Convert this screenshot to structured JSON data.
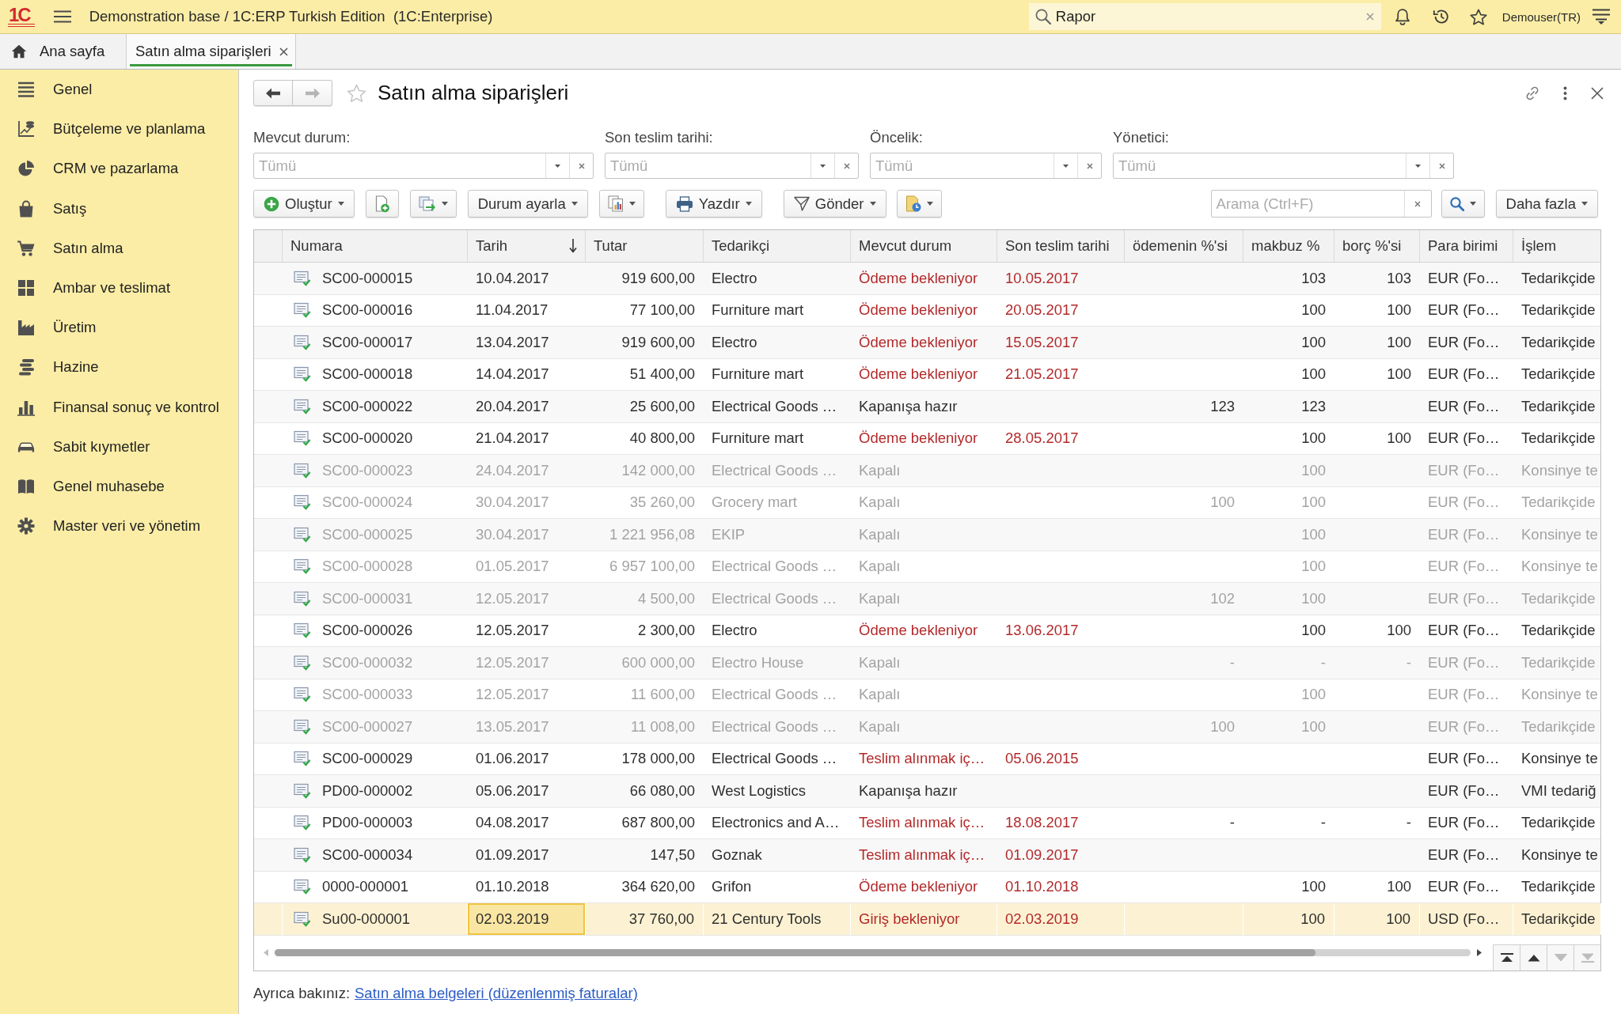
{
  "app": {
    "logo": "1C",
    "title": "Demonstration base / 1C:ERP Turkish Edition  (1C:Enterprise)",
    "search": {
      "value": "Rapor"
    },
    "user": "Demouser(TR)"
  },
  "tabs": [
    {
      "kind": "home",
      "label": "Ana sayfa",
      "selected": false
    },
    {
      "kind": "form",
      "label": "Satın alma siparişleri",
      "selected": true
    }
  ],
  "sidebar": {
    "items": [
      {
        "kind": "general",
        "label": "Genel",
        "selected": false
      },
      {
        "kind": "budget",
        "label": "Bütçeleme ve planlama",
        "selected": false
      },
      {
        "kind": "crm",
        "label": "CRM ve pazarlama",
        "selected": false
      },
      {
        "kind": "sales",
        "label": "Satış",
        "selected": false
      },
      {
        "kind": "purchase",
        "label": "Satın alma",
        "selected": false
      },
      {
        "kind": "warehouse",
        "label": "Ambar ve teslimat",
        "selected": false
      },
      {
        "kind": "production",
        "label": "Üretim",
        "selected": false
      },
      {
        "kind": "treasury",
        "label": "Hazine",
        "selected": false
      },
      {
        "kind": "finance",
        "label": "Finansal sonuç ve kontrol",
        "selected": false
      },
      {
        "kind": "assets",
        "label": "Sabit kıymetler",
        "selected": false
      },
      {
        "kind": "accounting",
        "label": "Genel muhasebe",
        "selected": false
      },
      {
        "kind": "settings",
        "label": "Master veri ve yönetim",
        "selected": false
      }
    ]
  },
  "form": {
    "title": "Satın alma siparişleri",
    "favorite": false,
    "back": {
      "disabled": false
    },
    "forward": {
      "disabled": true
    },
    "filters": [
      {
        "label": "Mevcut durum:",
        "placeholder": "Tümü"
      },
      {
        "label": "Son teslim tarihi:",
        "placeholder": "Tümü"
      },
      {
        "label": "Öncelik:",
        "placeholder": "Tümü"
      },
      {
        "label": "Yönetici:",
        "placeholder": "Tümü"
      }
    ],
    "toolbar": [
      {
        "kind": "create",
        "label": "Oluştur",
        "dropdown": true
      },
      {
        "kind": "copy",
        "dropdown": false
      },
      {
        "kind": "generate",
        "dropdown": true
      },
      {
        "kind": "status",
        "label": "Durum ayarla",
        "dropdown": true
      },
      {
        "kind": "reports",
        "dropdown": true
      },
      {
        "kind": "print",
        "label": "Yazdır",
        "dropdown": true
      },
      {
        "kind": "send",
        "label": "Gönder",
        "dropdown": true
      },
      {
        "kind": "attach",
        "dropdown": true
      }
    ],
    "search": {
      "placeholder": "Arama (Ctrl+F)"
    },
    "more_button": {
      "label": "Daha fazla"
    }
  },
  "table": {
    "columns": [
      {
        "label": "Numara",
        "sorted": false,
        "focused": false
      },
      {
        "label": "Tarih",
        "sorted": true,
        "focused": true
      },
      {
        "label": "Tutar",
        "sorted": false,
        "focused": false
      },
      {
        "label": "Tedarikçi",
        "sorted": false,
        "focused": false
      },
      {
        "label": "Mevcut durum",
        "sorted": false,
        "focused": false
      },
      {
        "label": "Son teslim tarihi",
        "sorted": false,
        "focused": false
      },
      {
        "label": "ödemenin %'si",
        "sorted": false,
        "focused": false
      },
      {
        "label": "makbuz %",
        "sorted": false,
        "focused": false
      },
      {
        "label": "borç %'si",
        "sorted": false,
        "focused": false
      },
      {
        "label": "Para birimi",
        "sorted": false,
        "focused": false
      },
      {
        "label": "İşlem",
        "sorted": false,
        "focused": false
      }
    ],
    "rows": [
      {
        "kind": "alert",
        "selected": false,
        "posted": true,
        "number": "SC00-000015",
        "date": "10.04.2017",
        "amount": "919 600,00",
        "supplier": "Electro",
        "status": "Ödeme bekleniyor",
        "due_date": "10.05.2017",
        "receipt_pct": "103",
        "debt_pct": "103",
        "currency": "EUR (Fo…",
        "operation": "Tedarikçide"
      },
      {
        "kind": "alert",
        "selected": false,
        "posted": true,
        "number": "SC00-000016",
        "date": "11.04.2017",
        "amount": "77 100,00",
        "supplier": "Furniture mart",
        "status": "Ödeme bekleniyor",
        "due_date": "20.05.2017",
        "receipt_pct": "100",
        "debt_pct": "100",
        "currency": "EUR (Fo…",
        "operation": "Tedarikçide"
      },
      {
        "kind": "alert",
        "selected": false,
        "posted": true,
        "number": "SC00-000017",
        "date": "13.04.2017",
        "amount": "919 600,00",
        "supplier": "Electro",
        "status": "Ödeme bekleniyor",
        "due_date": "15.05.2017",
        "receipt_pct": "100",
        "debt_pct": "100",
        "currency": "EUR (Fo…",
        "operation": "Tedarikçide"
      },
      {
        "kind": "alert",
        "selected": false,
        "posted": true,
        "number": "SC00-000018",
        "date": "14.04.2017",
        "amount": "51 400,00",
        "supplier": "Furniture mart",
        "status": "Ödeme bekleniyor",
        "due_date": "21.05.2017",
        "receipt_pct": "100",
        "debt_pct": "100",
        "currency": "EUR (Fo…",
        "operation": "Tedarikçide"
      },
      {
        "kind": "normal",
        "selected": false,
        "posted": true,
        "number": "SC00-000022",
        "date": "20.04.2017",
        "amount": "25 600,00",
        "supplier": "Electrical Goods …",
        "status": "Kapanışa hazır",
        "payment_pct": "123",
        "receipt_pct": "123",
        "currency": "EUR (Fo…",
        "operation": "Tedarikçide"
      },
      {
        "kind": "alert",
        "selected": false,
        "posted": true,
        "number": "SC00-000020",
        "date": "21.04.2017",
        "amount": "40 800,00",
        "supplier": "Furniture mart",
        "status": "Ödeme bekleniyor",
        "due_date": "28.05.2017",
        "receipt_pct": "100",
        "debt_pct": "100",
        "currency": "EUR (Fo…",
        "operation": "Tedarikçide"
      },
      {
        "kind": "closed",
        "selected": false,
        "posted": true,
        "number": "SC00-000023",
        "date": "24.04.2017",
        "amount": "142 000,00",
        "supplier": "Electrical Goods …",
        "status": "Kapalı",
        "receipt_pct": "100",
        "currency": "EUR (Fo…",
        "operation": "Konsinye te"
      },
      {
        "kind": "closed",
        "selected": false,
        "posted": true,
        "number": "SC00-000024",
        "date": "30.04.2017",
        "amount": "35 260,00",
        "supplier": "Grocery mart",
        "status": "Kapalı",
        "payment_pct": "100",
        "receipt_pct": "100",
        "currency": "EUR (Fo…",
        "operation": "Tedarikçide"
      },
      {
        "kind": "closed",
        "selected": false,
        "posted": true,
        "number": "SC00-000025",
        "date": "30.04.2017",
        "amount": "1 221 956,08",
        "supplier": "EKIP",
        "status": "Kapalı",
        "receipt_pct": "100",
        "currency": "EUR (Fo…",
        "operation": "Konsinye te"
      },
      {
        "kind": "closed",
        "selected": false,
        "posted": true,
        "number": "SC00-000028",
        "date": "01.05.2017",
        "amount": "6 957 100,00",
        "supplier": "Electrical Goods …",
        "status": "Kapalı",
        "receipt_pct": "100",
        "currency": "EUR (Fo…",
        "operation": "Konsinye te"
      },
      {
        "kind": "closed",
        "selected": false,
        "posted": true,
        "number": "SC00-000031",
        "date": "12.05.2017",
        "amount": "4 500,00",
        "supplier": "Electrical Goods …",
        "status": "Kapalı",
        "payment_pct": "102",
        "receipt_pct": "100",
        "currency": "EUR (Fo…",
        "operation": "Tedarikçide"
      },
      {
        "kind": "alert",
        "selected": false,
        "posted": true,
        "number": "SC00-000026",
        "date": "12.05.2017",
        "amount": "2 300,00",
        "supplier": "Electro",
        "status": "Ödeme bekleniyor",
        "due_date": "13.06.2017",
        "receipt_pct": "100",
        "debt_pct": "100",
        "currency": "EUR (Fo…",
        "operation": "Tedarikçide"
      },
      {
        "kind": "closed",
        "selected": false,
        "posted": true,
        "number": "SC00-000032",
        "date": "12.05.2017",
        "amount": "600 000,00",
        "supplier": "Electro House",
        "status": "Kapalı",
        "payment_pct": "-",
        "receipt_pct": "-",
        "debt_pct": "-",
        "currency": "EUR (Fo…",
        "operation": "Tedarikçide"
      },
      {
        "kind": "closed",
        "selected": false,
        "posted": true,
        "number": "SC00-000033",
        "date": "12.05.2017",
        "amount": "11 600,00",
        "supplier": "Electrical Goods …",
        "status": "Kapalı",
        "receipt_pct": "100",
        "currency": "EUR (Fo…",
        "operation": "Konsinye te"
      },
      {
        "kind": "closed",
        "selected": false,
        "posted": true,
        "number": "SC00-000027",
        "date": "13.05.2017",
        "amount": "11 008,00",
        "supplier": "Electrical Goods …",
        "status": "Kapalı",
        "payment_pct": "100",
        "receipt_pct": "100",
        "currency": "EUR (Fo…",
        "operation": "Tedarikçide"
      },
      {
        "kind": "alert",
        "selected": false,
        "posted": true,
        "number": "SC00-000029",
        "date": "01.06.2017",
        "amount": "178 000,00",
        "supplier": "Electrical Goods …",
        "status": "Teslim alınmak iç…",
        "due_date": "05.06.2015",
        "currency": "EUR (Fo…",
        "operation": "Konsinye te"
      },
      {
        "kind": "normal",
        "selected": false,
        "posted": true,
        "number": "PD00-000002",
        "date": "05.06.2017",
        "amount": "66 080,00",
        "supplier": "West Logistics",
        "status": "Kapanışa hazır",
        "currency": "EUR (Fo…",
        "operation": "VMI tedariğ"
      },
      {
        "kind": "alert",
        "selected": false,
        "posted": true,
        "number": "PD00-000003",
        "date": "04.08.2017",
        "amount": "687 800,00",
        "supplier": "Electronics and A…",
        "status": "Teslim alınmak iç…",
        "due_date": "18.08.2017",
        "payment_pct": "-",
        "receipt_pct": "-",
        "debt_pct": "-",
        "currency": "EUR (Fo…",
        "operation": "Tedarikçide"
      },
      {
        "kind": "alert",
        "selected": false,
        "posted": true,
        "number": "SC00-000034",
        "date": "01.09.2017",
        "amount": "147,50",
        "supplier": "Goznak",
        "status": "Teslim alınmak iç…",
        "due_date": "01.09.2017",
        "currency": "EUR (Fo…",
        "operation": "Konsinye te"
      },
      {
        "kind": "alert",
        "selected": false,
        "posted": true,
        "number": "0000-000001",
        "date": "01.10.2018",
        "amount": "364 620,00",
        "supplier": "Grifon",
        "status": "Ödeme bekleniyor",
        "due_date": "01.10.2018",
        "receipt_pct": "100",
        "debt_pct": "100",
        "currency": "EUR (Fo…",
        "operation": "Tedarikçide"
      },
      {
        "kind": "alert",
        "selected": true,
        "posted": true,
        "number": "Su00-000001",
        "date": "02.03.2019",
        "amount": "37 760,00",
        "supplier": "21 Century Tools",
        "status": "Giriş bekleniyor",
        "due_date": "02.03.2019",
        "receipt_pct": "100",
        "debt_pct": "100",
        "currency": "USD (Fo…",
        "operation": "Tedarikçide"
      }
    ],
    "row_nav": [
      {
        "kind": "first",
        "disabled": false
      },
      {
        "kind": "previous",
        "disabled": false
      },
      {
        "kind": "next",
        "disabled": true
      },
      {
        "kind": "last",
        "disabled": true
      }
    ]
  },
  "see_also": {
    "label": "Ayrıca bakınız:",
    "link": "Satın alma belgeleri (düzenlenmiş faturalar)"
  }
}
